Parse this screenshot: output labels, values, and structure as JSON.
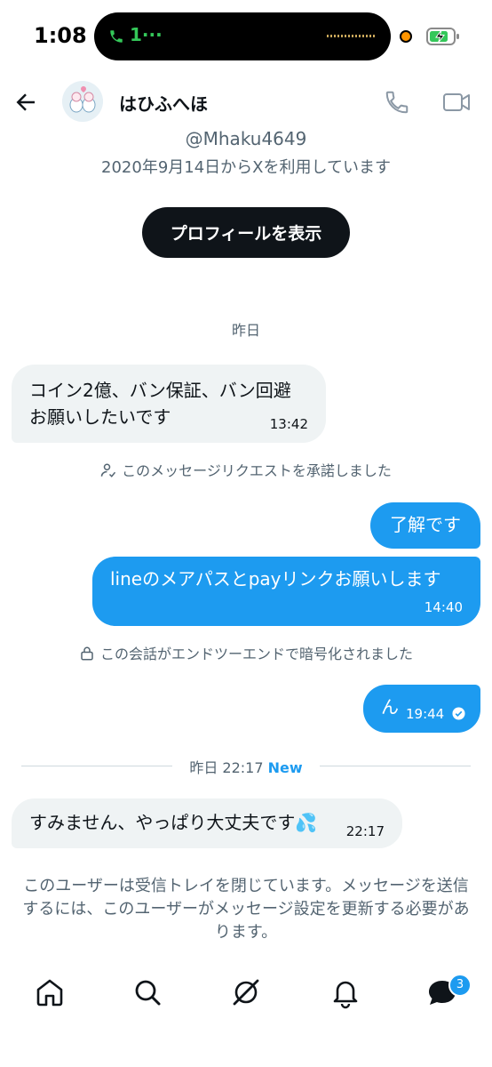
{
  "status_bar": {
    "time": "1:08",
    "call_timer": "1···"
  },
  "header": {
    "name": "はひふへほ",
    "handle": "@Mhaku4649",
    "joined": "2020年9月14日からXを利用しています",
    "profile_button": "プロフィールを表示"
  },
  "conversation": {
    "date_separator": "昨日",
    "messages": [
      {
        "side": "received",
        "text": "コイン2億、バン保証、バン回避\nお願いしたいです",
        "time": "13:42"
      },
      {
        "side": "system",
        "text": "このメッセージリクエストを承諾しました"
      },
      {
        "side": "sent",
        "text": "了解です",
        "time": ""
      },
      {
        "side": "sent",
        "text": "lineのメアパスとpayリンクお願いします",
        "time": "14:40"
      },
      {
        "side": "system",
        "text": "この会話がエンドツーエンドで暗号化されました"
      },
      {
        "side": "sent",
        "text": "ん",
        "time": "19:44"
      },
      {
        "side": "received",
        "text": "すみません、やっぱり大丈夫です💦",
        "time": "22:17"
      }
    ],
    "new_separator": {
      "label": "昨日 22:17",
      "new_label": "New"
    },
    "closed_notice": "このユーザーは受信トレイを閉じています。メッセージを送信するには、このユーザーがメッセージ設定を更新する必要があります。"
  },
  "tab_bar": {
    "items": [
      "home-icon",
      "search-icon",
      "grok-icon",
      "notifications-icon",
      "messages-icon"
    ],
    "messages_badge": "3"
  },
  "colors": {
    "accent": "#1d9bf0",
    "text": "#0f1419",
    "secondary": "#536471",
    "bubble_received": "#eff3f4"
  }
}
